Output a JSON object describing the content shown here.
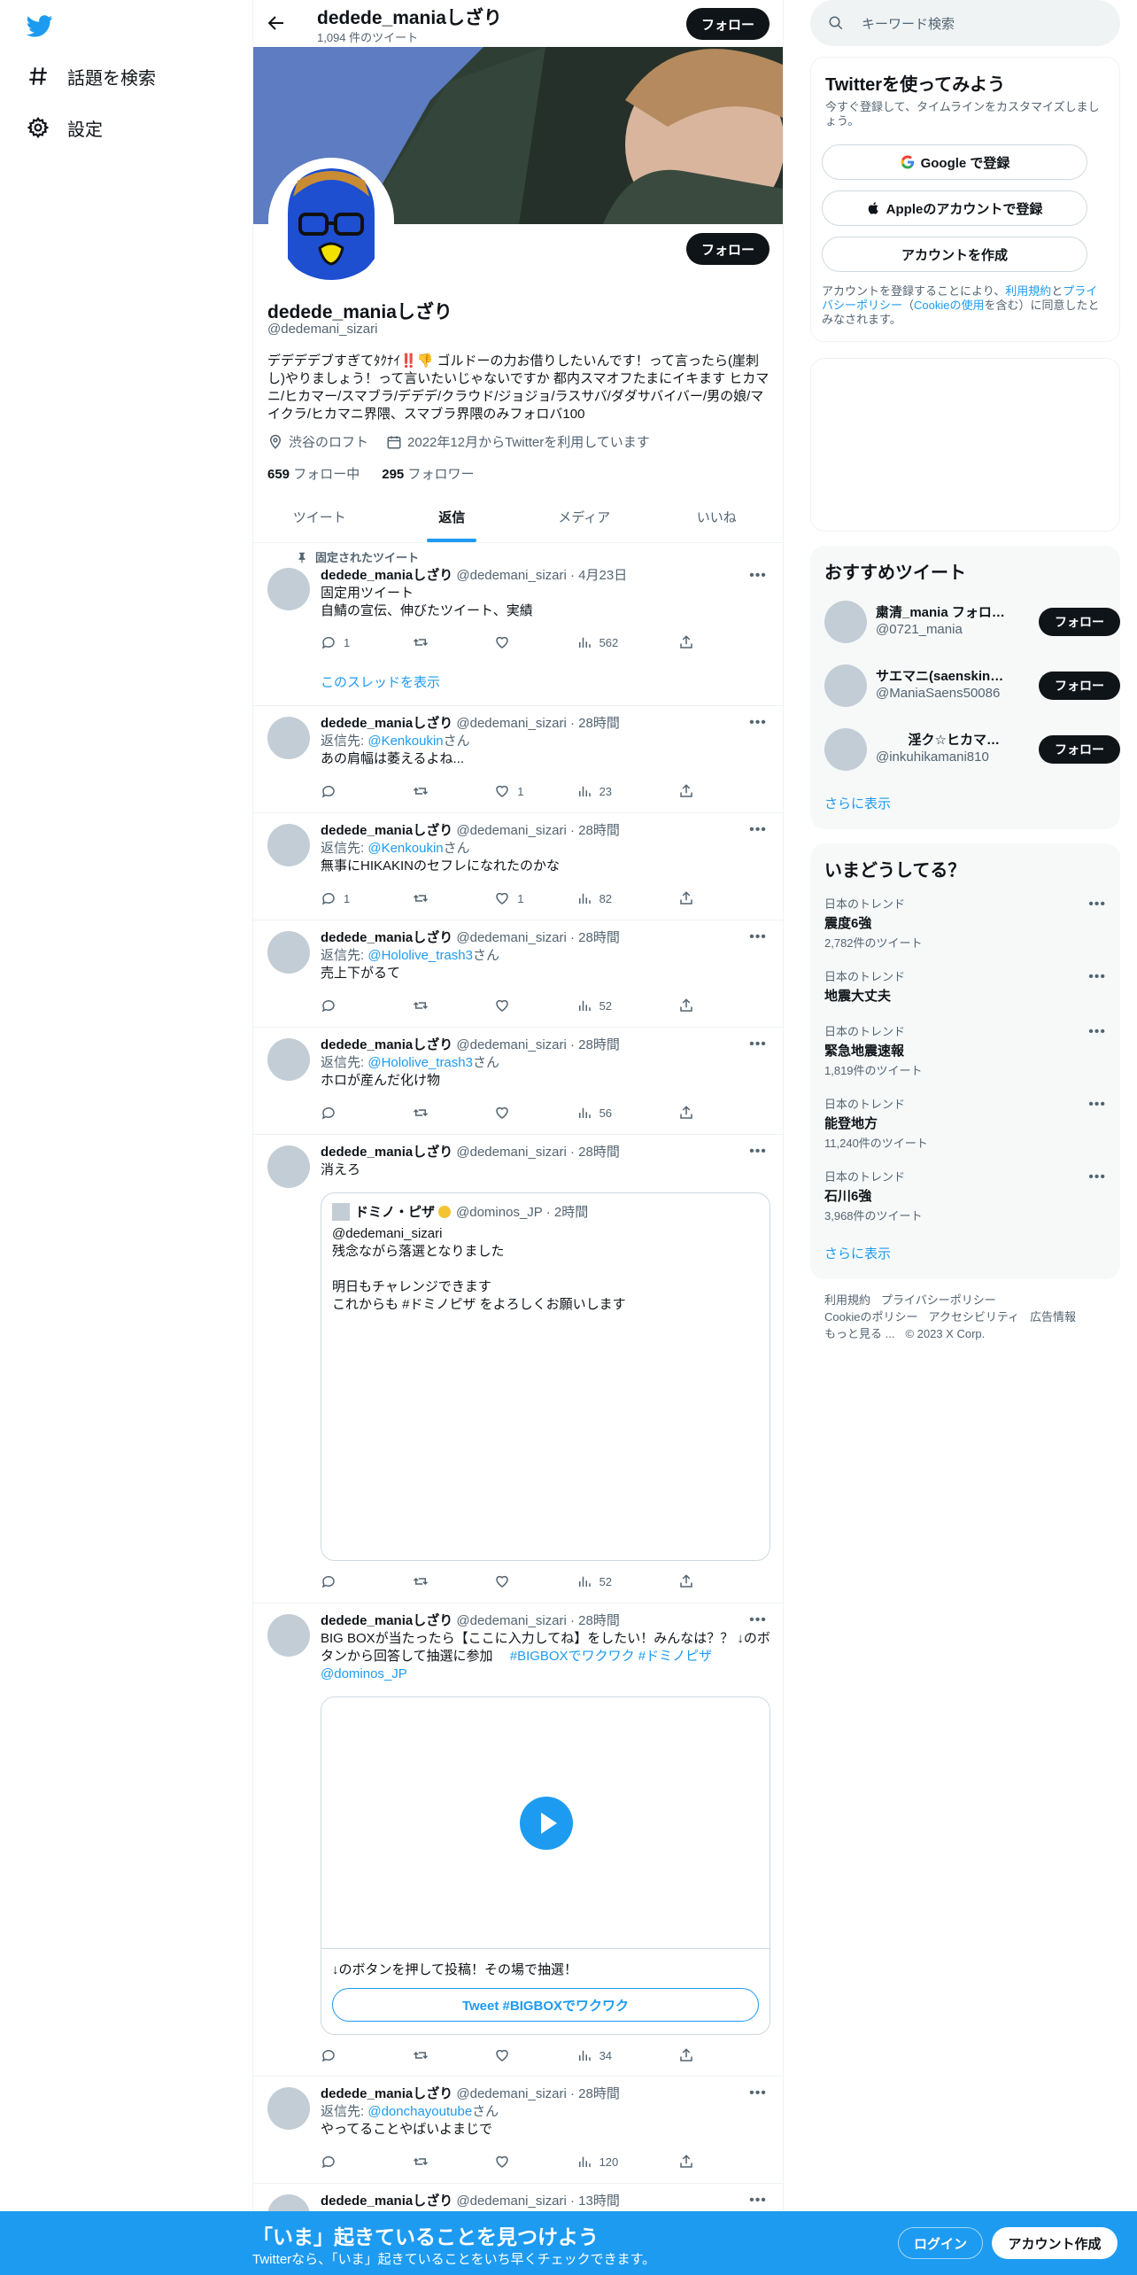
{
  "nav": {
    "items": [
      {
        "label": "話題を検索",
        "icon": "hashtag-icon"
      },
      {
        "label": "設定",
        "icon": "gear-icon"
      }
    ]
  },
  "profile": {
    "top_name": "dedede_maniaしざり",
    "tweet_count": "1,094 件のツイート",
    "follow_label": "フォロー",
    "name": "dedede_maniaしざり",
    "handle": "@dedemani_sizari",
    "bio": "デデデデブすぎてﾀｸﾅｲ‼️👎 ゴルドーの力お借りしたいんです！って言ったら(崖刺し)やりましょう！って言いたいじゃないですか 都内スマオフたまにイキます ヒカマニ/ヒカマー/スマブラ/デデデ/クラウド/ジョジョ/ラスサバ/ダダサバイバー/男の娘/マイクラ/ヒカマニ界隈、スマブラ界隈のみフォロバ100",
    "location": "渋谷のロフト",
    "joined": "2022年12月からTwitterを利用しています",
    "following_count": "659",
    "following_label": "フォロー中",
    "followers_count": "295",
    "followers_label": "フォロワー"
  },
  "tabs": [
    "ツイート",
    "返信",
    "メディア",
    "いいね"
  ],
  "tweets": [
    {
      "pinned": "固定されたツイート",
      "name": "dedede_maniaしざり",
      "meta": "@dedemani_sizari · 4月23日",
      "text": "固定用ツイート\n自鯖の宣伝、伸びたツイート、実績",
      "reply": "1",
      "retweet": "",
      "like": "",
      "views": "562",
      "thread": "このスレッドを表示"
    },
    {
      "name": "dedede_maniaしざり",
      "meta": "@dedemani_sizari · 28時間",
      "reply_to_prefix": "返信先: ",
      "reply_to": "@Kenkoukin",
      "reply_to_suffix": "さん",
      "text": "あの肩幅は萎えるよね...",
      "reply": "",
      "retweet": "",
      "like": "1",
      "views": "23"
    },
    {
      "name": "dedede_maniaしざり",
      "meta": "@dedemani_sizari · 28時間",
      "reply_to_prefix": "返信先: ",
      "reply_to": "@Kenkoukin",
      "reply_to_suffix": "さん",
      "text": "無事にHIKAKINのセフレになれたのかな",
      "reply": "1",
      "retweet": "",
      "like": "1",
      "views": "82"
    },
    {
      "name": "dedede_maniaしざり",
      "meta": "@dedemani_sizari · 28時間",
      "reply_to_prefix": "返信先: ",
      "reply_to": "@Hololive_trash3",
      "reply_to_suffix": "さん",
      "text": "売上下がるて",
      "reply": "",
      "retweet": "",
      "like": "",
      "views": "52"
    },
    {
      "name": "dedede_maniaしざり",
      "meta": "@dedemani_sizari · 28時間",
      "reply_to_prefix": "返信先: ",
      "reply_to": "@Hololive_trash3",
      "reply_to_suffix": "さん",
      "text": "ホロが産んだ化け物",
      "reply": "",
      "retweet": "",
      "like": "",
      "views": "56"
    },
    {
      "name": "dedede_maniaしざり",
      "meta": "@dedemani_sizari · 28時間",
      "text": "消えろ",
      "reply": "",
      "retweet": "",
      "like": "",
      "views": "52",
      "quote": {
        "name": "ドミノ・ピザ",
        "meta": "@dominos_JP · 2時間",
        "text": "@dedemani_sizari\n残念ながら落選となりました\n\n明日もチャレンジできます\nこれからも #ドミノピザ をよろしくお願いします"
      }
    },
    {
      "name": "dedede_maniaしざり",
      "meta": "@dedemani_sizari · 28時間",
      "text": "BIG BOXが当たったら【ここに入力してね】をしたい！みんなは？？ ↓のボタンから回答して抽選に参加　",
      "hashtags": "#BIGBOXでワクワク #ドミノピザ",
      "mention": "@dominos_JP",
      "reply": "",
      "retweet": "",
      "like": "",
      "views": "34",
      "card": {
        "caption": "↓のボタンを押して投稿！その場で抽選！",
        "button": "Tweet #BIGBOXでワクワク"
      }
    },
    {
      "name": "dedede_maniaしざり",
      "meta": "@dedemani_sizari · 28時間",
      "reply_to_prefix": "返信先: ",
      "reply_to": "@donchayoutube",
      "reply_to_suffix": "さん",
      "text": "やってることやばいよまじで",
      "reply": "",
      "retweet": "",
      "like": "",
      "views": "120"
    },
    {
      "name": "dedede_maniaしざり",
      "meta": "@dedemani_sizari · 13時間"
    }
  ],
  "search": {
    "placeholder": "キーワード検索"
  },
  "signup": {
    "title": "Twitterを使ってみよう",
    "subtitle": "今すぐ登録して、タイムラインをカスタマイズしましょう。",
    "google": "Google で登録",
    "apple": "Appleのアカウントで登録",
    "create": "アカウントを作成",
    "terms_pre": "アカウントを登録することにより、",
    "terms_link1": "利用規約",
    "terms_mid": "と",
    "terms_link2": "プライバシーポリシー",
    "terms_paren_open": "（",
    "terms_link3": "Cookieの使用",
    "terms_post": "を含む）に同意したとみなされます。"
  },
  "recommend": {
    "title": "おすすめツイート",
    "users": [
      {
        "name": "粛清_mania フォロ…",
        "handle": "@0721_mania"
      },
      {
        "name": "サエマニ(saenskin_…",
        "handle": "@ManiaSaens50086"
      },
      {
        "name": "淫ク☆ヒカマ…",
        "handle": "@inkuhikamani810"
      }
    ],
    "follow": "フォロー",
    "more": "さらに表示"
  },
  "trends": {
    "title": "いまどうしてる？",
    "items": [
      {
        "category": "日本のトレンド",
        "name": "震度6強",
        "count": "2,782件のツイート"
      },
      {
        "category": "日本のトレンド",
        "name": "地震大丈夫",
        "count": ""
      },
      {
        "category": "日本のトレンド",
        "name": "緊急地震速報",
        "count": "1,819件のツイート"
      },
      {
        "category": "日本のトレンド",
        "name": "能登地方",
        "count": "11,240件のツイート"
      },
      {
        "category": "日本のトレンド",
        "name": "石川6強",
        "count": "3,968件のツイート"
      }
    ],
    "more": "さらに表示"
  },
  "footer": {
    "line1a": "利用規約",
    "line1b": "プライバシーポリシー",
    "line2a": "Cookieのポリシー",
    "line2b": "アクセシビリティ",
    "line2c": "広告情報",
    "line3a": "もっと見る ...",
    "line3b": "© 2023 X Corp."
  },
  "bottom": {
    "title": "「いま」起きていることを見つけよう",
    "subtitle": "Twitterなら、「いま」起きていることをいち早くチェックできます。",
    "login": "ログイン",
    "signup": "アカウント作成"
  },
  "colors": {
    "accent": "#1d9bf0",
    "dark": "#0f1419",
    "muted": "#536471"
  }
}
